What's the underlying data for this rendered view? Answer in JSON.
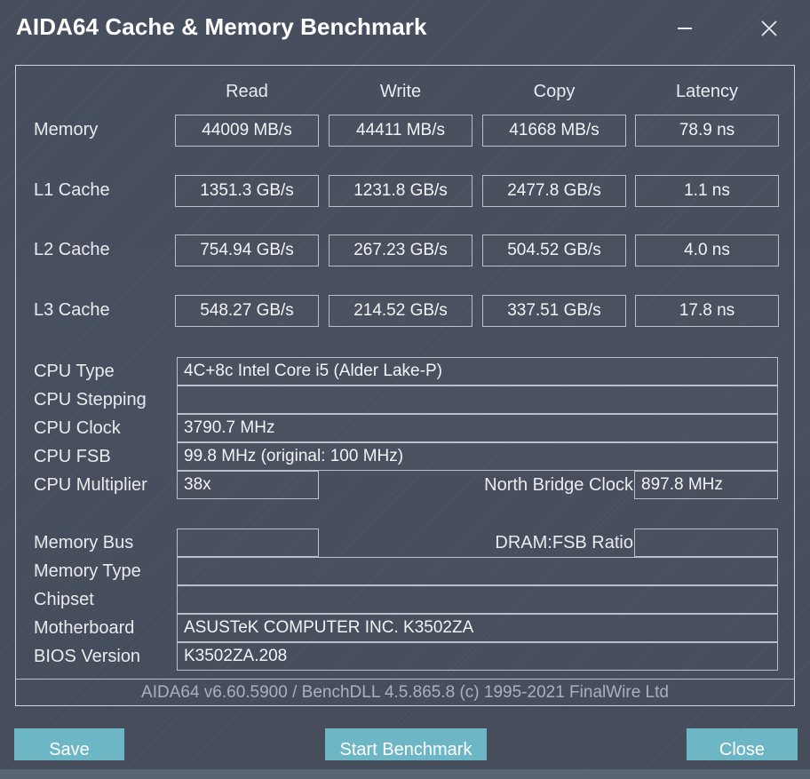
{
  "window": {
    "title": "AIDA64 Cache & Memory Benchmark",
    "minimize_label": "Minimize",
    "close_label": "Close",
    "accent_color": "#6db6c6",
    "background_color": "#474e5d",
    "border_color": "#cfd4db"
  },
  "benchmark": {
    "columns": [
      "Read",
      "Write",
      "Copy",
      "Latency"
    ],
    "rows": [
      {
        "label": "Memory",
        "read": "44009 MB/s",
        "write": "44411 MB/s",
        "copy": "41668 MB/s",
        "latency": "78.9 ns"
      },
      {
        "label": "L1 Cache",
        "read": "1351.3 GB/s",
        "write": "1231.8 GB/s",
        "copy": "2477.8 GB/s",
        "latency": "1.1 ns"
      },
      {
        "label": "L2 Cache",
        "read": "754.94 GB/s",
        "write": "267.23 GB/s",
        "copy": "504.52 GB/s",
        "latency": "4.0 ns"
      },
      {
        "label": "L3 Cache",
        "read": "548.27 GB/s",
        "write": "214.52 GB/s",
        "copy": "337.51 GB/s",
        "latency": "17.8 ns"
      }
    ]
  },
  "cpu_info": {
    "type_label": "CPU Type",
    "type_value": "4C+8c Intel Core i5  (Alder Lake-P)",
    "stepping_label": "CPU Stepping",
    "stepping_value": "",
    "clock_label": "CPU Clock",
    "clock_value": "3790.7 MHz",
    "fsb_label": "CPU FSB",
    "fsb_value": "99.8 MHz  (original: 100 MHz)",
    "multiplier_label": "CPU Multiplier",
    "multiplier_value": "38x",
    "north_bridge_label": "North Bridge Clock",
    "north_bridge_value": "897.8 MHz"
  },
  "system_info": {
    "memory_bus_label": "Memory Bus",
    "memory_bus_value": "",
    "dram_fsb_label": "DRAM:FSB Ratio",
    "dram_fsb_value": "",
    "memory_type_label": "Memory Type",
    "memory_type_value": "",
    "chipset_label": "Chipset",
    "chipset_value": "",
    "motherboard_label": "Motherboard",
    "motherboard_value": "ASUSTeK COMPUTER INC. K3502ZA",
    "bios_label": "BIOS Version",
    "bios_value": "K3502ZA.208"
  },
  "footer": {
    "version_text": "AIDA64 v6.60.5900 / BenchDLL 4.5.865.8  (c) 1995-2021 FinalWire Ltd"
  },
  "buttons": {
    "save": "Save",
    "start_benchmark": "Start Benchmark",
    "close": "Close"
  }
}
